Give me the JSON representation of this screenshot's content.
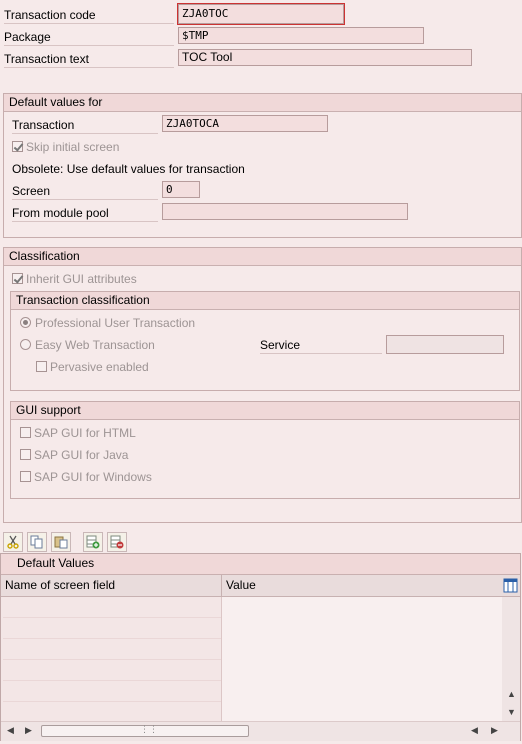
{
  "header": {
    "transaction_code_label": "Transaction code",
    "transaction_code_value": "ZJA0TOC",
    "package_label": "Package",
    "package_value": "$TMP",
    "transaction_text_label": "Transaction text",
    "transaction_text_value": "TOC Tool"
  },
  "default_values": {
    "title": "Default values for",
    "transaction_label": "Transaction",
    "transaction_value": "ZJA0TOCA",
    "skip_initial_screen_label": "Skip initial screen",
    "skip_initial_screen_checked": true,
    "obsolete_text": "Obsolete: Use default values for transaction",
    "screen_label": "Screen",
    "screen_value": "0",
    "module_pool_label": "From module pool",
    "module_pool_value": ""
  },
  "classification": {
    "title": "Classification",
    "inherit_gui_label": "Inherit GUI attributes",
    "inherit_gui_checked": true,
    "transaction_classification": {
      "title": "Transaction classification",
      "professional_label": "Professional User Transaction",
      "professional_selected": true,
      "easy_web_label": "Easy Web Transaction",
      "easy_web_selected": false,
      "service_label": "Service",
      "service_value": "",
      "pervasive_label": "Pervasive enabled",
      "pervasive_checked": false
    },
    "gui_support": {
      "title": "GUI support",
      "html_label": "SAP GUI for HTML",
      "java_label": "SAP GUI for Java",
      "windows_label": "SAP GUI for Windows"
    }
  },
  "toolbar": {
    "icons": [
      "cut-icon",
      "copy-icon",
      "paste-icon",
      "insert-row-icon",
      "delete-row-icon"
    ]
  },
  "default_values_table": {
    "title": "Default Values",
    "columns": [
      "Name of screen field",
      "Value"
    ],
    "rows": []
  }
}
